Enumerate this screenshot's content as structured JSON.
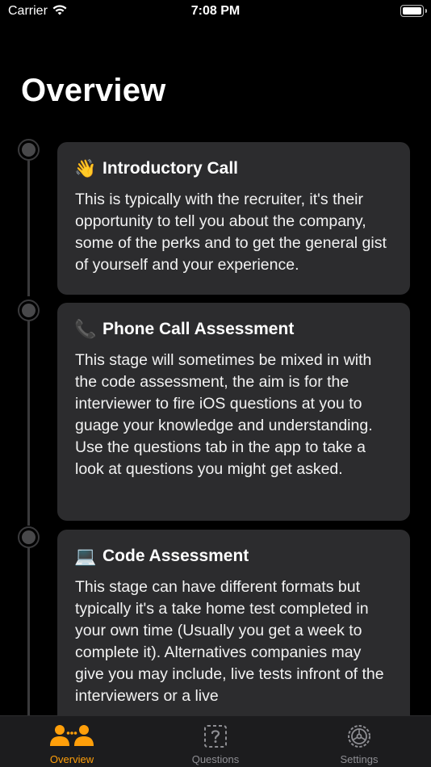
{
  "status_bar": {
    "carrier": "Carrier",
    "time": "7:08 PM"
  },
  "page_title": "Overview",
  "stages": [
    {
      "icon": "waving-hand-icon",
      "emoji": "👋",
      "title": "Introductory Call",
      "body": "This is typically with the recruiter, it's their opportunity to tell you about the company, some of the perks and to get the general gist of yourself and your experience."
    },
    {
      "icon": "phone-icon",
      "emoji": "📞",
      "title": "Phone Call Assessment",
      "body": "This stage will sometimes be mixed in with the code assessment, the aim is for the interviewer to fire iOS questions at you to guage your knowledge and understanding. Use the questions tab in the app to take a look at questions you might get asked."
    },
    {
      "icon": "laptop-icon",
      "emoji": "💻",
      "title": "Code Assessment",
      "body": "This stage can have different formats but typically it's a take home test completed in your own time (Usually you get a week to complete it). Alternatives companies may give you may include, live tests infront of the interviewers or a live"
    }
  ],
  "tabs": [
    {
      "label": "Overview",
      "icon": "people-icon",
      "active": true
    },
    {
      "label": "Questions",
      "icon": "question-square-icon",
      "active": false
    },
    {
      "label": "Settings",
      "icon": "gear-icon",
      "active": false
    }
  ],
  "colors": {
    "accent": "#FF9F0A",
    "inactive_tab": "#8E8E93",
    "card": "#2C2C2E",
    "background": "#000000"
  }
}
